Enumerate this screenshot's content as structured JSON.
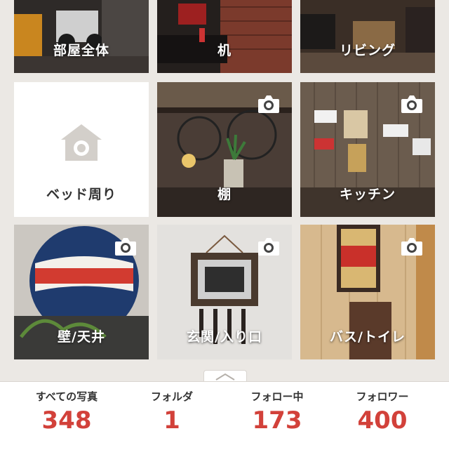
{
  "folders": [
    {
      "label": "部屋全体",
      "has_camera": false
    },
    {
      "label": "机",
      "has_camera": false
    },
    {
      "label": "リビング",
      "has_camera": false
    },
    {
      "label": "ベッド周り",
      "has_camera": false,
      "empty": true
    },
    {
      "label": "棚",
      "has_camera": true
    },
    {
      "label": "キッチン",
      "has_camera": true
    },
    {
      "label": "壁/天井",
      "has_camera": true
    },
    {
      "label": "玄関/入り口",
      "has_camera": true
    },
    {
      "label": "バス/トイレ",
      "has_camera": true
    }
  ],
  "stats": [
    {
      "label": "すべての写真",
      "value": "348"
    },
    {
      "label": "フォルダ",
      "value": "1"
    },
    {
      "label": "フォロー中",
      "value": "173"
    },
    {
      "label": "フォロワー",
      "value": "400"
    }
  ],
  "icons": {
    "camera": "camera-icon",
    "house_camera": "house-camera-icon",
    "chevron": "chevron-up-icon"
  },
  "colors": {
    "accent": "#d2413a",
    "background": "#ebe8e4"
  }
}
